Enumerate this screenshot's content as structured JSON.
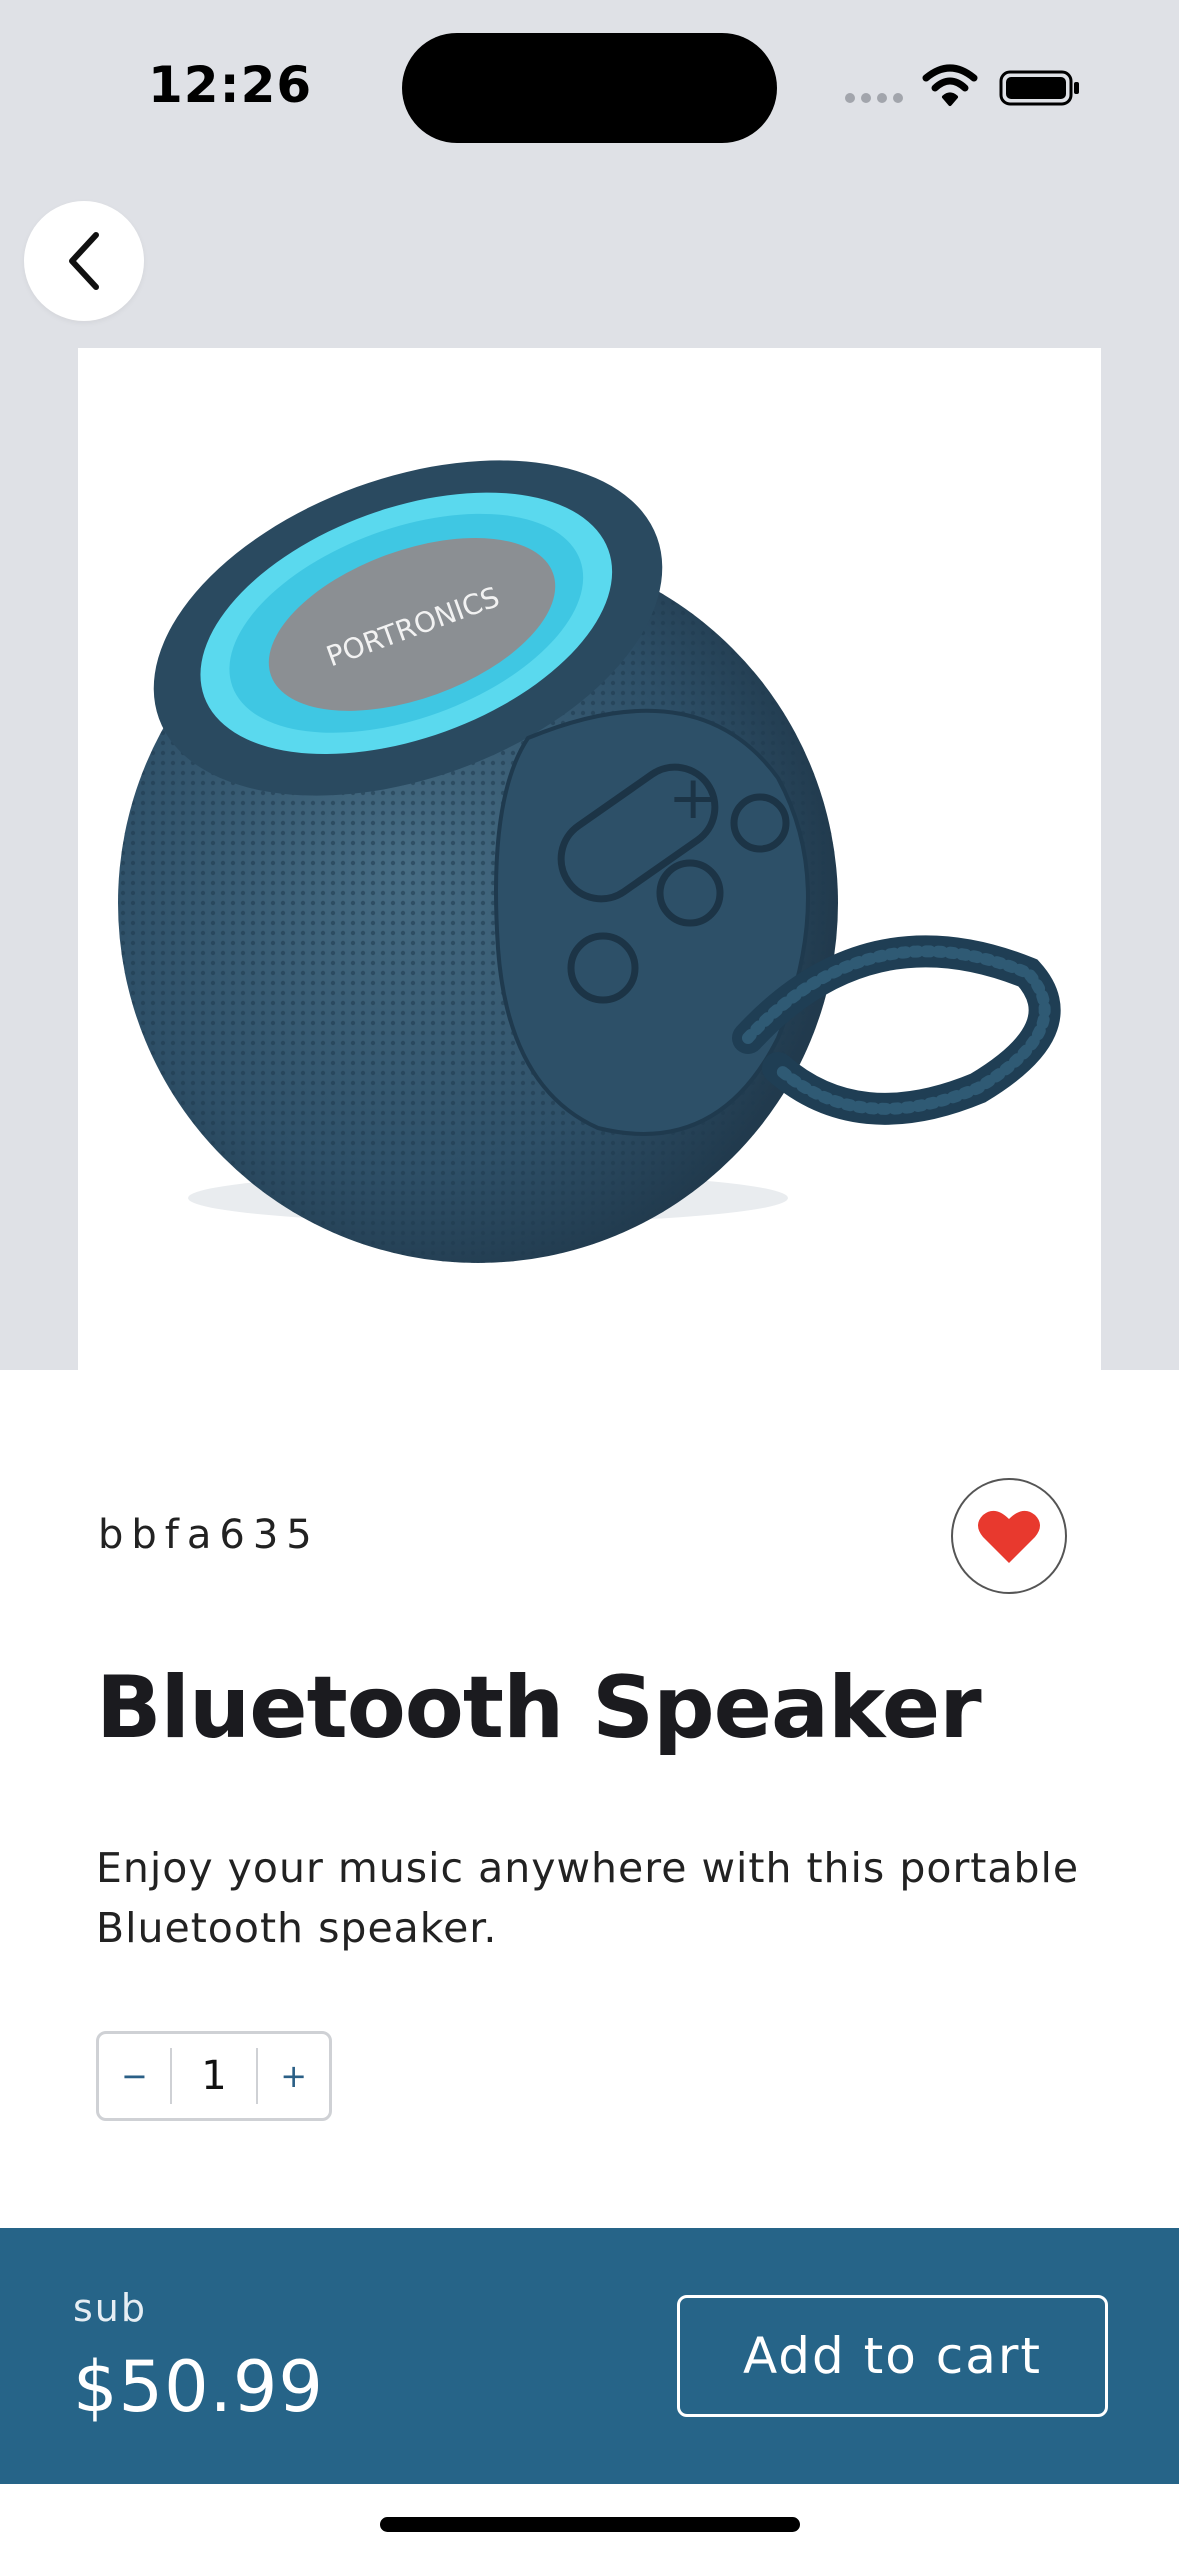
{
  "status_bar": {
    "time": "12:26"
  },
  "product": {
    "sku": "bbfa635",
    "title": "Bluetooth Speaker",
    "description": "Enjoy your music anywhere with this portable Bluetooth speaker.",
    "image_logo_text": "PORTRONICS",
    "favorited": true
  },
  "quantity": {
    "minus": "−",
    "value": "1",
    "plus": "+"
  },
  "footer": {
    "sub_label": "sub",
    "price": "$50.99",
    "add_to_cart": "Add to cart"
  },
  "colors": {
    "accent": "#266488",
    "heart": "#e8392e",
    "top_background": "#dfe1e6"
  },
  "icons": [
    "back-chevron-icon",
    "heart-icon",
    "wifi-icon",
    "battery-icon",
    "signal-icon"
  ]
}
